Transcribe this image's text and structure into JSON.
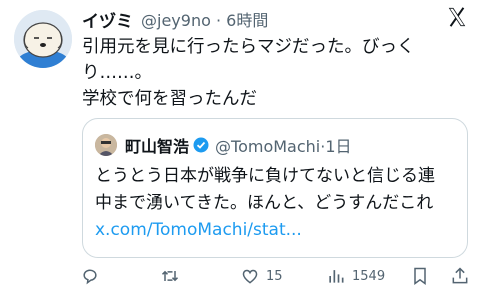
{
  "tweet": {
    "display_name": "イヅミ",
    "handle": "@jey9no",
    "time": "6時間",
    "text_lines": [
      "引用元を見に行ったらマジだった。びっく",
      "り……。",
      "学校で何を習ったんだ"
    ]
  },
  "quote": {
    "display_name": "町山智浩",
    "handle": "@TomoMachi",
    "time": "1日",
    "text_lines": [
      "とうとう日本が戦争に負けてないと信じる連",
      "中まで湧いてきた。ほんと、どうすんだこれ"
    ],
    "link": "x.com/TomoMachi/stat..."
  },
  "actions": {
    "likes": "15",
    "views": "1549"
  },
  "icons": {
    "logo": "x-logo-icon",
    "verified": "verified-badge-icon",
    "reply": "reply-icon",
    "retweet": "retweet-icon",
    "like": "heart-icon",
    "views": "views-icon",
    "bookmark": "bookmark-icon",
    "share": "share-icon"
  },
  "colors": {
    "link": "#1d9bf0",
    "muted": "#536471",
    "verified": "#1d9bf0"
  }
}
